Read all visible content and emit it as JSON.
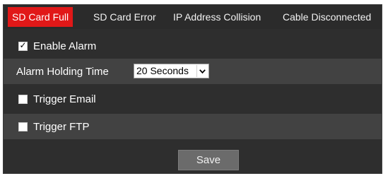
{
  "tabs": [
    {
      "label": "SD Card Full",
      "active": true
    },
    {
      "label": "SD Card Error",
      "active": false
    },
    {
      "label": "IP Address Collision",
      "active": false
    },
    {
      "label": "Cable Disconnected",
      "active": false
    }
  ],
  "enable_alarm": {
    "label": "Enable Alarm",
    "checked": true
  },
  "alarm_holding_time": {
    "label": "Alarm Holding Time",
    "value": "20 Seconds"
  },
  "trigger_email": {
    "label": "Trigger Email",
    "checked": false
  },
  "trigger_ftp": {
    "label": "Trigger FTP",
    "checked": false
  },
  "save_label": "Save",
  "colors": {
    "active_tab": "#e11818",
    "panel_bg": "#2e2e2e",
    "alt_row_bg": "#424242",
    "button_bg": "#6b6b6b"
  },
  "icons": {
    "checkbox_checked": "check-mark-icon",
    "select_arrow": "chevron-down-icon"
  }
}
